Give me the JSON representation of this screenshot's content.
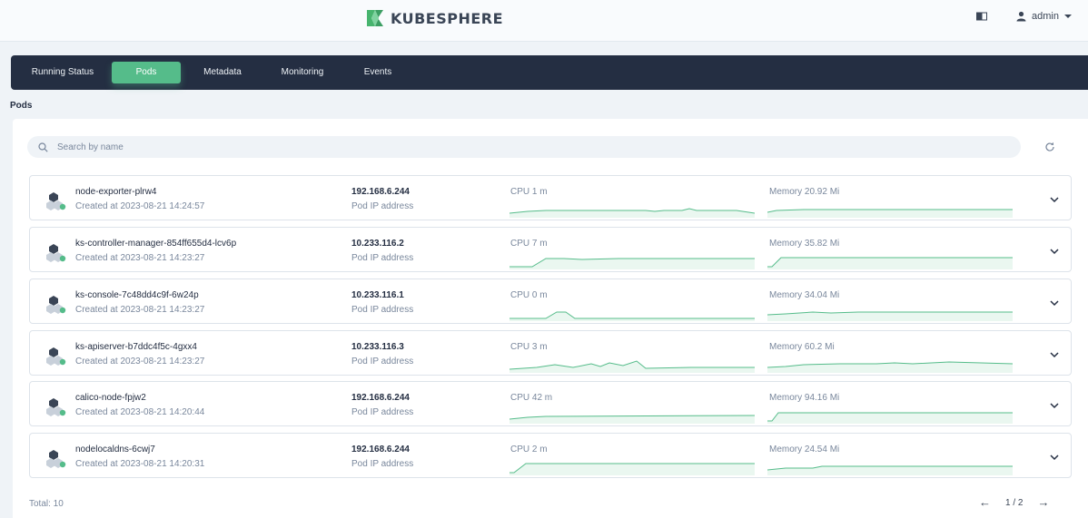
{
  "header": {
    "brand": "KUBESPHERE",
    "user": "admin"
  },
  "tabs": [
    {
      "label": "Running Status"
    },
    {
      "label": "Pods"
    },
    {
      "label": "Metadata"
    },
    {
      "label": "Monitoring"
    },
    {
      "label": "Events"
    }
  ],
  "section_title": "Pods",
  "search": {
    "placeholder": "Search by name"
  },
  "pods": [
    {
      "name": "node-exporter-plrw4",
      "created": "Created at 2023-08-21 14:24:57",
      "ip": "192.168.6.244",
      "ip_label": "Pod IP address",
      "cpu": "CPU 1 m",
      "memory": "Memory 20.92 Mi"
    },
    {
      "name": "ks-controller-manager-854ff655d4-lcv6p",
      "created": "Created at 2023-08-21 14:23:27",
      "ip": "10.233.116.2",
      "ip_label": "Pod IP address",
      "cpu": "CPU 7 m",
      "memory": "Memory 35.82 Mi"
    },
    {
      "name": "ks-console-7c48dd4c9f-6w24p",
      "created": "Created at 2023-08-21 14:23:27",
      "ip": "10.233.116.1",
      "ip_label": "Pod IP address",
      "cpu": "CPU 0 m",
      "memory": "Memory 34.04 Mi"
    },
    {
      "name": "ks-apiserver-b7ddc4f5c-4gxx4",
      "created": "Created at 2023-08-21 14:23:27",
      "ip": "10.233.116.3",
      "ip_label": "Pod IP address",
      "cpu": "CPU 3 m",
      "memory": "Memory 60.2 Mi"
    },
    {
      "name": "calico-node-fpjw2",
      "created": "Created at 2023-08-21 14:20:44",
      "ip": "192.168.6.244",
      "ip_label": "Pod IP address",
      "cpu": "CPU 42 m",
      "memory": "Memory 94.16 Mi"
    },
    {
      "name": "nodelocaldns-6cwj7",
      "created": "Created at 2023-08-21 14:20:31",
      "ip": "192.168.6.244",
      "ip_label": "Pod IP address",
      "cpu": "CPU 2 m",
      "memory": "Memory 24.54 Mi"
    }
  ],
  "footer": {
    "total": "Total: 10",
    "page": "1 / 2"
  },
  "colors": {
    "accent": "#55bc8a",
    "nav_bg": "#242e42",
    "page_bg": "#eff3f7"
  },
  "icons": {
    "brand": "kubesphere-logo-icon",
    "layout": "layout-toggle-icon",
    "user": "user-icon",
    "caret": "caret-down-icon",
    "search": "search-icon",
    "refresh": "refresh-icon",
    "pod": "pod-icon",
    "expand": "chevron-down-icon",
    "prev": "arrow-left-icon",
    "next": "arrow-right-icon"
  }
}
